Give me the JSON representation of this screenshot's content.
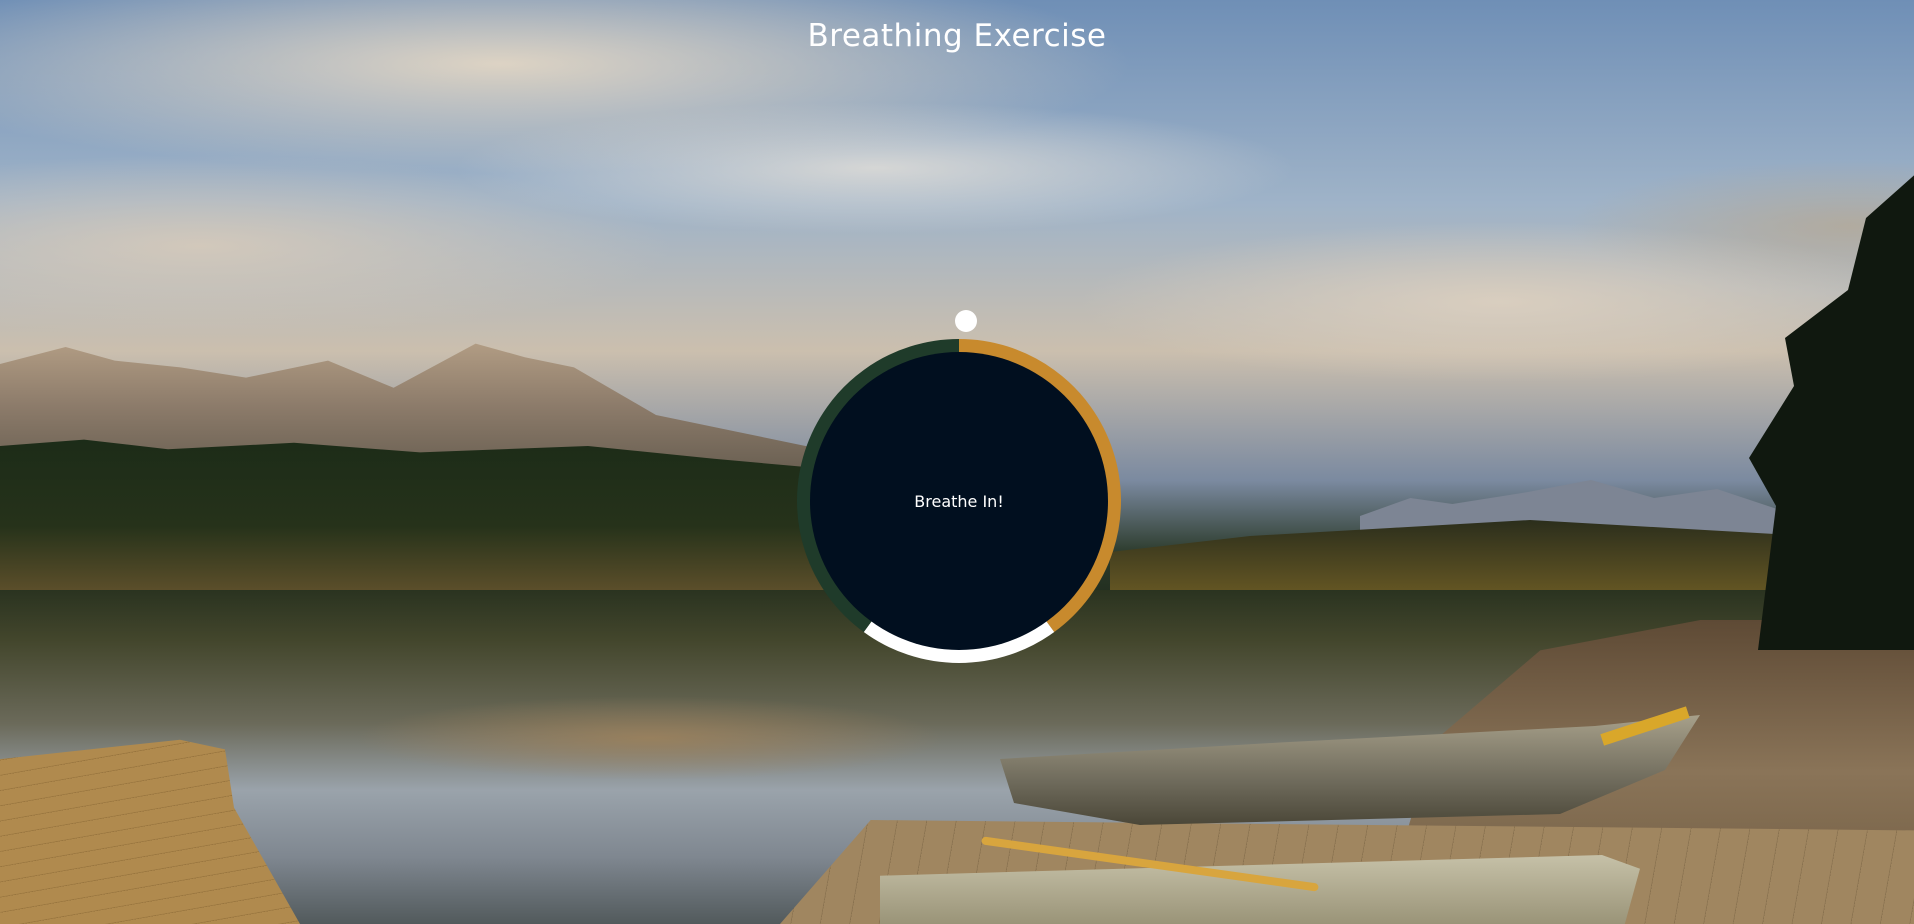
{
  "page": {
    "title": "Breathing Exercise"
  },
  "breather": {
    "status_text": "Breathe In!",
    "phases": [
      {
        "name": "breathe-in",
        "fraction": 0.4,
        "color": "#c88a2d"
      },
      {
        "name": "hold",
        "fraction": 0.2,
        "color": "#ffffff"
      },
      {
        "name": "breathe-out",
        "fraction": 0.4,
        "color": "#1f3b2a"
      }
    ],
    "inner_color": "#010f1f",
    "pointer_color": "#ffffff",
    "pointer_position": 0.0
  }
}
